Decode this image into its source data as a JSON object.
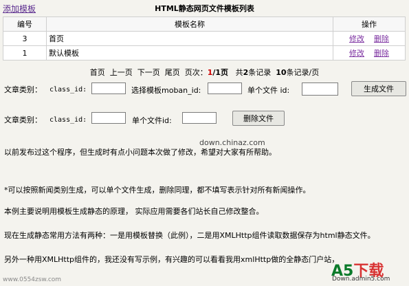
{
  "header": {
    "add_link": "添加模板",
    "title": "HTML静态网页文件模板列表"
  },
  "table": {
    "columns": [
      "编号",
      "模板名称",
      "操作"
    ],
    "rows": [
      {
        "id": "3",
        "name": "首页",
        "edit": "修改",
        "delete": "删除"
      },
      {
        "id": "1",
        "name": "默认模板",
        "edit": "修改",
        "delete": "删除"
      }
    ]
  },
  "pager": {
    "first": "首页",
    "prev": "上一页",
    "next": "下一页",
    "last": "尾页",
    "page_label": "页次：",
    "current": "1",
    "total_pages": "/1页",
    "total_label": "共",
    "total_count": "2",
    "records_label": "条记录",
    "per_page": "10",
    "per_page_label": "条记录/页"
  },
  "form1": {
    "category_label": "文章类别：",
    "class_id_label": "class_id:",
    "select_template_label": "选择模板moban_id:",
    "single_file_label": "单个文件 id:",
    "button": "生成文件"
  },
  "form2": {
    "category_label": "文章类别：",
    "class_id_label": "class_id:",
    "single_file_label": "单个文件id:",
    "button": "删除文件"
  },
  "watermark": "down.chinaz.com",
  "paragraphs": [
    "以前发布过这个程序，但生成时有点小问题本次做了修改，希望对大家有所帮助。",
    "*可以按照新闻类别生成，可以单个文件生成，删除同理，都不填写表示针对所有新闻操作。",
    "本例主要说明用模板生成静态的原理， 实际应用需要各们站长自己修改整合。",
    "现在生成静态常用方法有两种：一是用模板替换（此例），二是用XMLHttp组件读取数据保存为html静态文件。",
    "另外一种用XMLHttp组件的，我还没有写示例，有兴趣的可以看看我用xmlHttp做的全静态门户站，"
  ],
  "footer": {
    "site": "www.0554zsw.com",
    "logo_main": "A5",
    "logo_accent": "下载",
    "logo_sub": "Down.admin5.com"
  }
}
